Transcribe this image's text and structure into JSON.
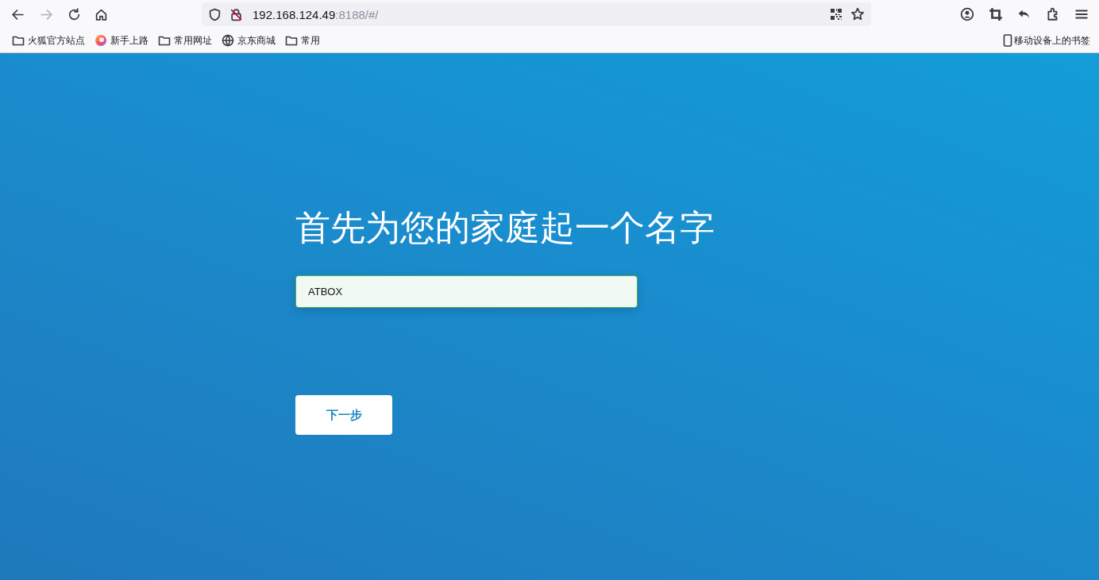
{
  "toolbar": {
    "back_enabled": true,
    "forward_enabled": false,
    "url_host": "192.168.124.49",
    "url_rest": ":8188/#/"
  },
  "bookmarks": [
    {
      "kind": "folder",
      "label": "火狐官方站点"
    },
    {
      "kind": "firefox",
      "label": "新手上路"
    },
    {
      "kind": "folder",
      "label": "常用网址"
    },
    {
      "kind": "globe",
      "label": "京东商城"
    },
    {
      "kind": "folder",
      "label": "常用"
    }
  ],
  "mobile_bookmarks": {
    "label": "移动设备上的书签"
  },
  "page": {
    "heading": "首先为您的家庭起一个名字",
    "name_field": {
      "value": "ATBOX",
      "focused": true
    },
    "next_button": "下一步"
  }
}
